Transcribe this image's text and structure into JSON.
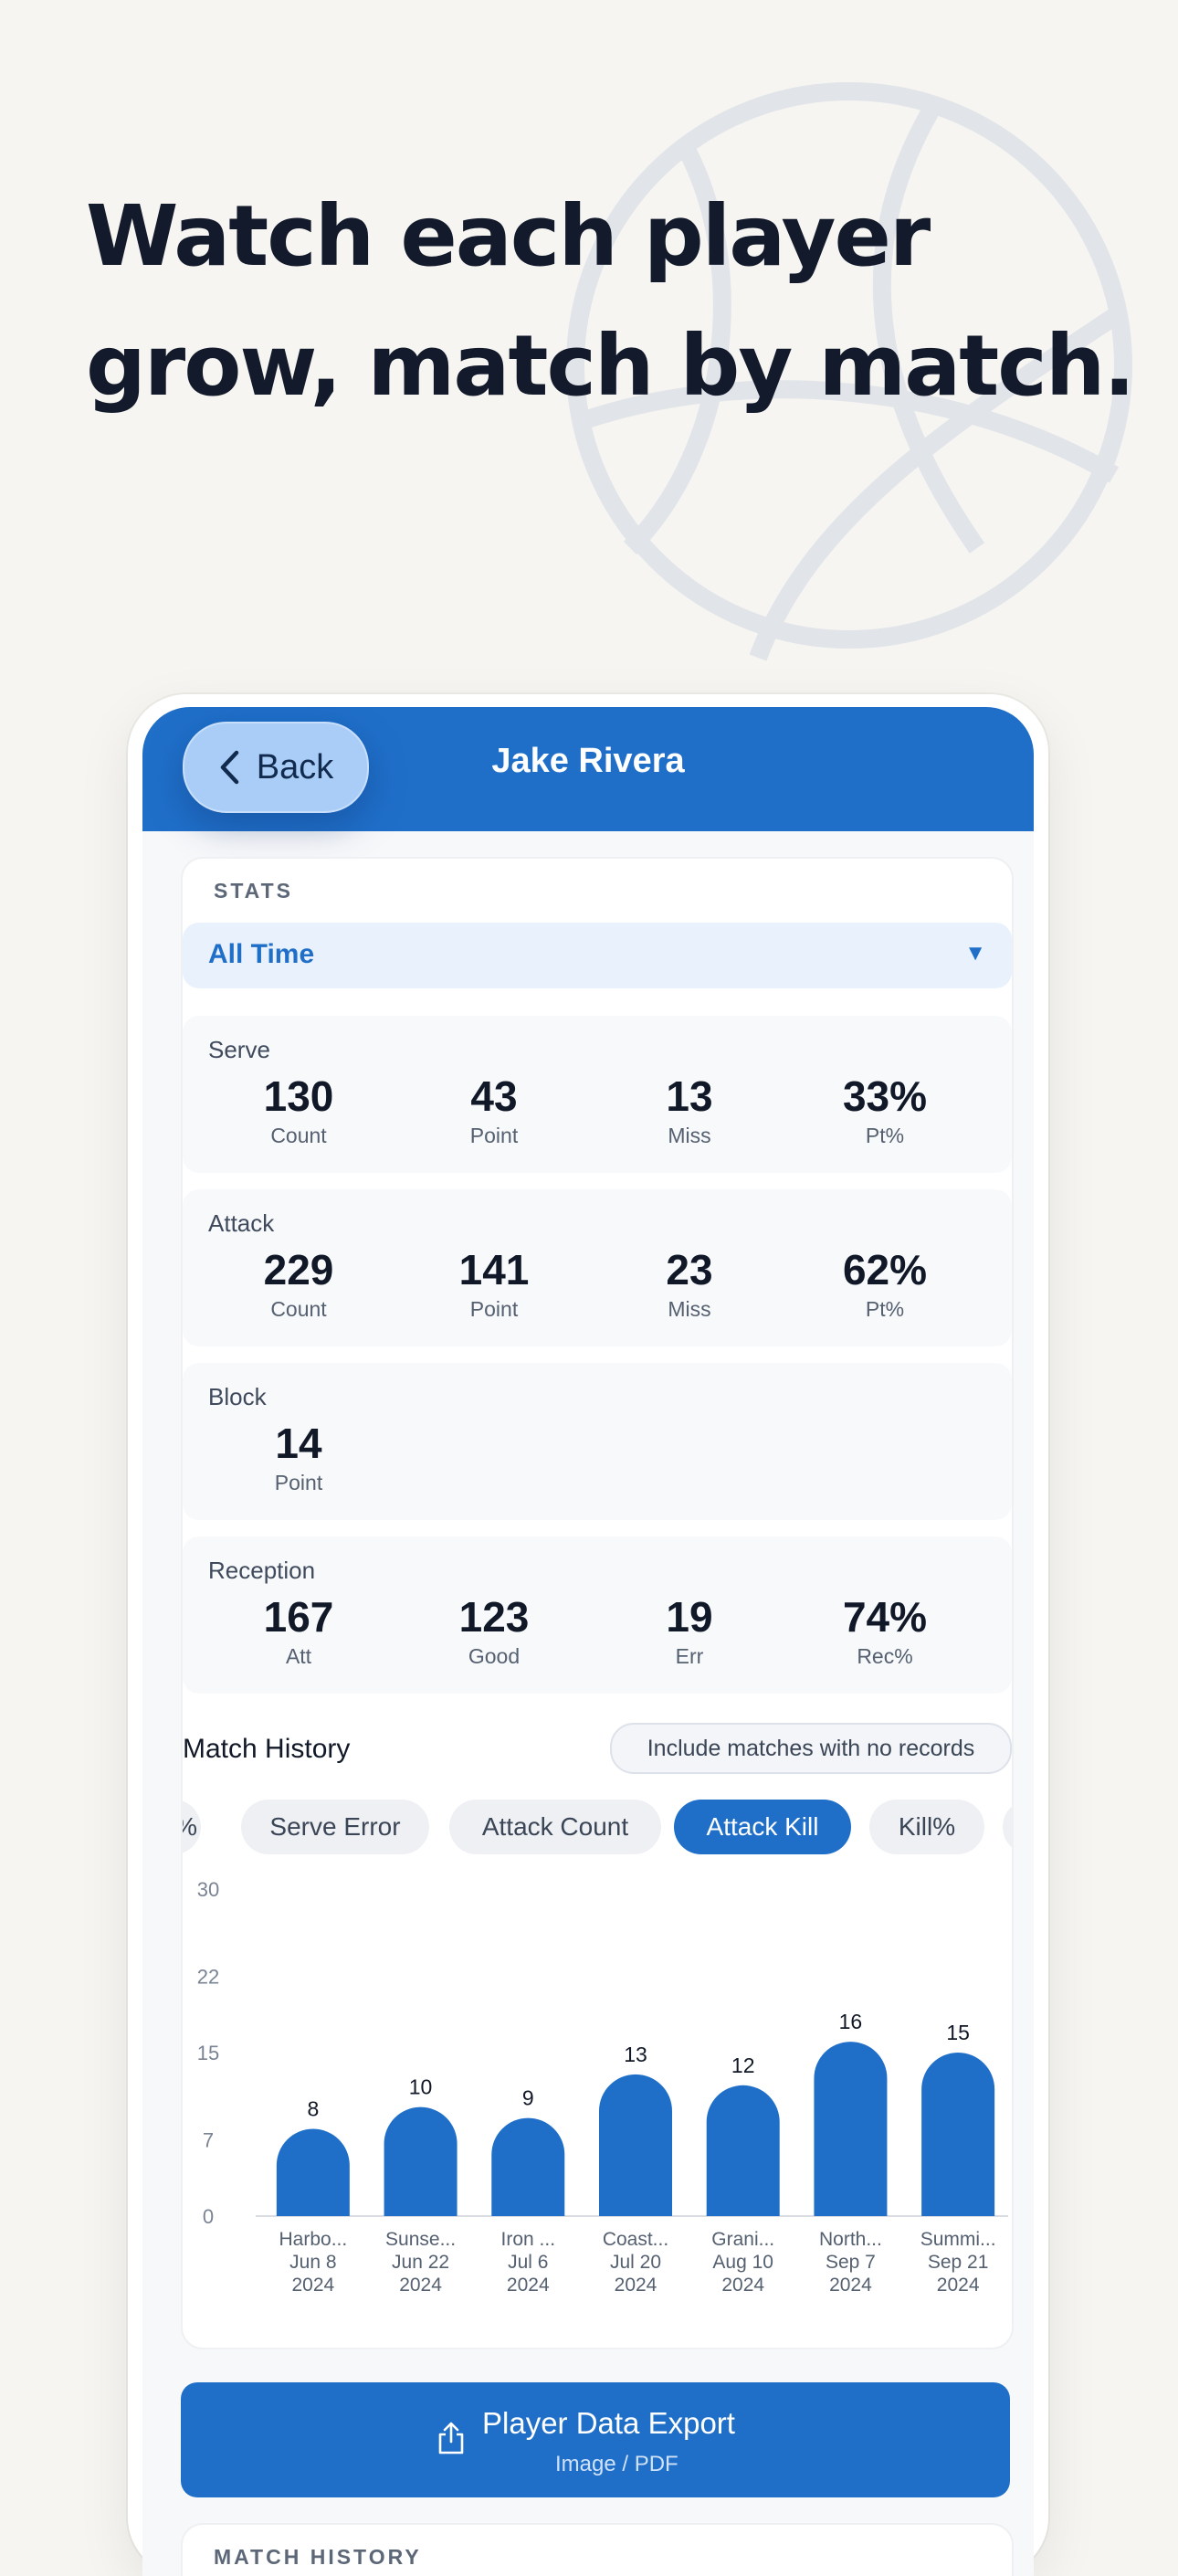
{
  "headline": {
    "line1": "Watch each player",
    "line2": "grow, match by match."
  },
  "nav": {
    "back_label": "Back",
    "title": "Jake Rivera"
  },
  "stats": {
    "section_label": "STATS",
    "period": "All Time",
    "blocks": [
      {
        "title": "Serve",
        "cells": [
          {
            "value": "130",
            "label": "Count"
          },
          {
            "value": "43",
            "label": "Point"
          },
          {
            "value": "13",
            "label": "Miss"
          },
          {
            "value": "33%",
            "label": "Pt%"
          }
        ]
      },
      {
        "title": "Attack",
        "cells": [
          {
            "value": "229",
            "label": "Count"
          },
          {
            "value": "141",
            "label": "Point"
          },
          {
            "value": "23",
            "label": "Miss"
          },
          {
            "value": "62%",
            "label": "Pt%"
          }
        ]
      },
      {
        "title": "Block",
        "cells": [
          {
            "value": "14",
            "label": "Point"
          }
        ]
      },
      {
        "title": "Reception",
        "cells": [
          {
            "value": "167",
            "label": "Att"
          },
          {
            "value": "123",
            "label": "Good"
          },
          {
            "value": "19",
            "label": "Err"
          },
          {
            "value": "74%",
            "label": "Rec%"
          }
        ]
      }
    ]
  },
  "match_history": {
    "title": "Match History",
    "include_toggle": "Include matches with no records",
    "metric_chips": [
      "%",
      "Serve Error",
      "Attack Count",
      "Attack Kill",
      "Kill%"
    ],
    "active_chip": "Attack Kill"
  },
  "chart_data": {
    "type": "bar",
    "title": "",
    "xlabel": "",
    "ylabel": "",
    "ylim": [
      0,
      30
    ],
    "yticks": [
      "0",
      "7",
      "15",
      "22",
      "30"
    ],
    "categories": [
      {
        "name": "Harbo...",
        "date": "Jun 8",
        "year": "2024"
      },
      {
        "name": "Sunse...",
        "date": "Jun 22",
        "year": "2024"
      },
      {
        "name": "Iron ...",
        "date": "Jul 6",
        "year": "2024"
      },
      {
        "name": "Coast...",
        "date": "Jul 20",
        "year": "2024"
      },
      {
        "name": "Grani...",
        "date": "Aug 10",
        "year": "2024"
      },
      {
        "name": "North...",
        "date": "Sep 7",
        "year": "2024"
      },
      {
        "name": "Summi...",
        "date": "Sep 21",
        "year": "2024"
      }
    ],
    "values": [
      8,
      10,
      9,
      13,
      12,
      16,
      15
    ],
    "bar_color": "#1f6fc9"
  },
  "export": {
    "label": "Player Data Export",
    "sublabel": "Image / PDF"
  },
  "match_history_card": {
    "section_label": "MATCH HISTORY"
  },
  "colors": {
    "primary": "#1f6fc9",
    "background": "#f6f5f1",
    "headline": "#121a2c"
  }
}
